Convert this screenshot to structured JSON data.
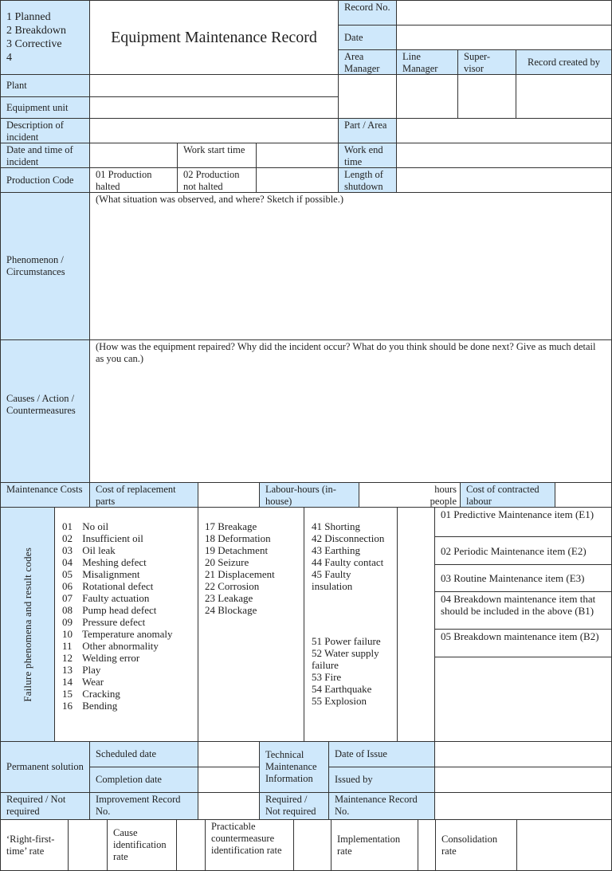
{
  "header": {
    "record_types": [
      "1 Planned",
      "2 Breakdown",
      "3 Corrective",
      "4"
    ],
    "title": "Equipment Maintenance Record",
    "record_no_label": "Record No.",
    "date_label": "Date",
    "approvals": [
      "Area Manager",
      "Line Manager",
      "Super-visor",
      "Record created by"
    ]
  },
  "fields": {
    "plant": "Plant",
    "equipment_unit": "Equipment unit",
    "description": "Description of incident",
    "part_area": "Part / Area",
    "date_time": "Date and time of incident",
    "work_start": "Work start time",
    "work_end": "Work end time",
    "production_code": "Production Code",
    "prod_halted": "01 Production halted",
    "prod_not_halted": "02 Production not halted",
    "length_shutdown": "Length of shutdown"
  },
  "phenomenon": {
    "label": "Phenomenon / Circumstances",
    "hint": "(What situation was observed, and where? Sketch if possible.)"
  },
  "causes": {
    "label": "Causes / Action / Countermeasures",
    "hint": "(How was the equipment repaired? Why did the incident occur? What do you think should be done next?  Give as much detail as you can.)"
  },
  "costs": {
    "label": "Maintenance Costs",
    "replacement_parts": "Cost of replacement parts",
    "labour_hours": "Labour-hours (in-house)",
    "hours_unit": "hours",
    "people_unit": "people",
    "contracted_labour": "Cost of contracted labour"
  },
  "failure_codes": {
    "label": "Failure phenomena  and result codes",
    "col1": [
      [
        "01",
        "No oil"
      ],
      [
        "02",
        "Insufficient oil"
      ],
      [
        "03",
        "Oil leak"
      ],
      [
        "04",
        "Meshing defect"
      ],
      [
        "05",
        "Misalignment"
      ],
      [
        "06",
        "Rotational defect"
      ],
      [
        "07",
        "Faulty actuation"
      ],
      [
        "08",
        "Pump head defect"
      ],
      [
        "09",
        "Pressure defect"
      ],
      [
        "10",
        "Temperature anomaly"
      ],
      [
        "11",
        "Other abnormality"
      ],
      [
        "12",
        "Welding error"
      ],
      [
        "13",
        "Play"
      ],
      [
        "14",
        "Wear"
      ],
      [
        "15",
        "Cracking"
      ],
      [
        "16",
        "Bending"
      ]
    ],
    "col2": [
      "17 Breakage",
      "18 Deformation",
      "19 Detachment",
      "20 Seizure",
      "21 Displacement",
      "22 Corrosion",
      "23 Leakage",
      "24 Blockage"
    ],
    "col3a": [
      "41 Shorting",
      "42 Disconnection",
      "43 Earthing",
      "44 Faulty contact",
      "45 Faulty insulation"
    ],
    "col3b": [
      "51 Power failure",
      "52 Water supply failure",
      "53 Fire",
      "54 Earthquake",
      "55 Explosion"
    ],
    "maintenance_items": [
      "01 Predictive Maintenance item (E1)",
      "02 Periodic Maintenance item (E2)",
      "03 Routine Maintenance item (E3)",
      "04 Breakdown maintenance item that should be included in the above (B1)",
      "05 Breakdown maintenance item (B2)"
    ]
  },
  "permanent": {
    "label": "Permanent solution",
    "scheduled": "Scheduled date",
    "completion": "Completion date",
    "technical": "Technical Maintenance Information",
    "date_issue": "Date of Issue",
    "issued_by": "Issued by",
    "required1": "Required / Not required",
    "improvement_no": "Improvement Record No.",
    "required2": "Required / Not required",
    "maint_record_no": "Maintenance Record No."
  },
  "rates": [
    "‘Right-first-time’ rate",
    "Cause identification rate",
    "Practicable countermeasure identification rate",
    "Implementation rate",
    "Consolidation rate"
  ]
}
